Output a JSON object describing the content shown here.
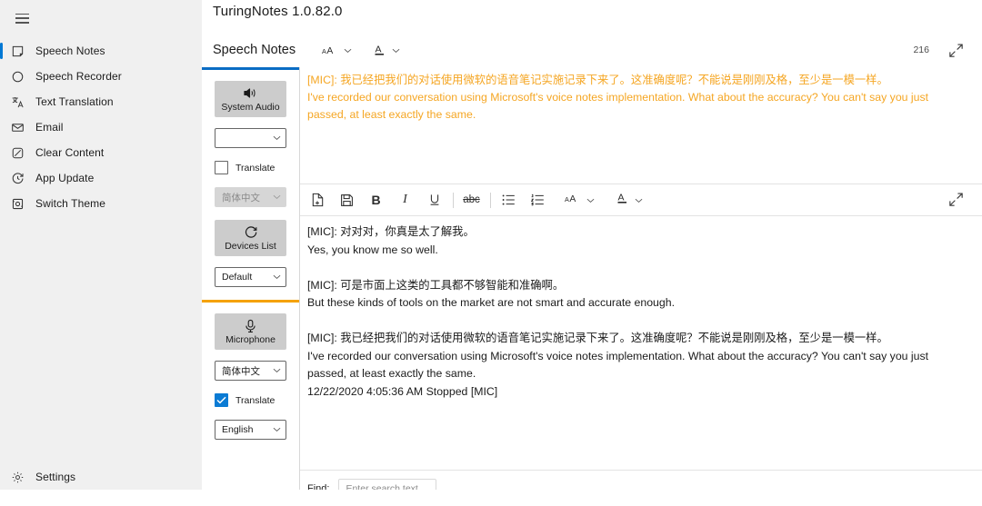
{
  "window": {
    "app_title": "TuringNotes 1.0.82.0"
  },
  "sidebar": {
    "menu_icon": "hamburger-icon",
    "items": [
      {
        "label": "Speech Notes",
        "icon": "note-icon",
        "selected": true
      },
      {
        "label": "Speech Recorder",
        "icon": "circle-icon",
        "selected": false
      },
      {
        "label": "Text Translation",
        "icon": "translate-icon",
        "selected": false
      },
      {
        "label": "Email",
        "icon": "envelope-icon",
        "selected": false
      },
      {
        "label": "Clear Content",
        "icon": "eraser-icon",
        "selected": false
      },
      {
        "label": "App Update",
        "icon": "refresh-clock-icon",
        "selected": false
      },
      {
        "label": "Switch Theme",
        "icon": "theme-icon",
        "selected": false
      }
    ],
    "settings": {
      "label": "Settings",
      "icon": "gear-icon"
    }
  },
  "tabbar": {
    "tab_label": "Speech Notes",
    "font_size_label": "AA",
    "font_color_label": "A",
    "char_count": "216",
    "expand_icon": "expand-diagonal-icon"
  },
  "controls": {
    "accent_top_color": "#0a6cc4",
    "accent_mid_color": "#f5a200",
    "system_audio": {
      "label": "System Audio",
      "icon": "speaker-icon"
    },
    "system_audio_device": {
      "value": "",
      "icon": "chevron-down-icon"
    },
    "translate_top": {
      "label": "Translate",
      "checked": false
    },
    "translate_top_lang": {
      "value": "简体中文",
      "disabled": true
    },
    "devices_list": {
      "label": "Devices List",
      "icon": "refresh-icon"
    },
    "devices_value": {
      "value": "Default"
    },
    "microphone": {
      "label": "Microphone",
      "icon": "microphone-icon"
    },
    "mic_lang": {
      "value": "简体中文"
    },
    "translate_bottom": {
      "label": "Translate",
      "checked": true
    },
    "translate_bottom_lang": {
      "value": "English"
    }
  },
  "top_pane": {
    "text_color": "#f5a623",
    "text": "[MIC]: 我已经把我们的对话使用微软的语音笔记实施记录下来了。这准确度呢？不能说是刚刚及格，至少是一模一样。\nI've recorded our conversation using Microsoft's voice notes implementation. What about the accuracy? You can't say you just passed, at least exactly the same."
  },
  "format_toolbar": {
    "buttons": [
      {
        "name": "new-document-icon",
        "label": ""
      },
      {
        "name": "save-icon",
        "label": ""
      },
      {
        "name": "bold-icon",
        "label": "B"
      },
      {
        "name": "italic-icon",
        "label": "I"
      },
      {
        "name": "underline-icon",
        "label": "U"
      },
      {
        "name": "strikethrough-icon",
        "label": "abc"
      },
      {
        "name": "bullet-list-icon",
        "label": ""
      },
      {
        "name": "numbered-list-icon",
        "label": ""
      }
    ],
    "font_size_label": "AA",
    "font_color_label": "A",
    "expand_icon": "expand-diagonal-icon"
  },
  "main_pane": {
    "text": "[MIC]: 对对对，你真是太了解我。\nYes, you know me so well.\n\n[MIC]: 可是市面上这类的工具都不够智能和准确啊。\nBut these kinds of tools on the market are not smart and accurate enough.\n\n[MIC]: 我已经把我们的对话使用微软的语音笔记实施记录下来了。这准确度呢？不能说是刚刚及格，至少是一模一样。\nI've recorded our conversation using Microsoft's voice notes implementation. What about the accuracy? You can't say you just passed, at least exactly the same.\n12/22/2020 4:05:36 AM Stopped [MIC]"
  },
  "find_bar": {
    "label": "Find:",
    "placeholder": "Enter search text",
    "value": ""
  }
}
